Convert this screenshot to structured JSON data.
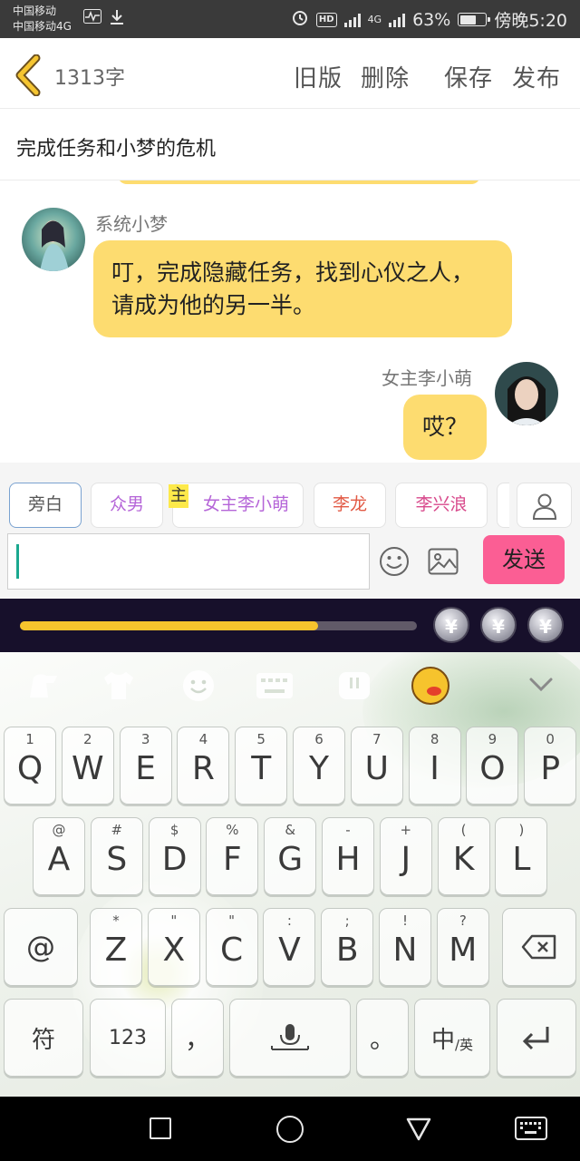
{
  "status_bar": {
    "carrier_1": "中国移动",
    "carrier_2": "中国移动4G",
    "network": "4G",
    "battery": "63%",
    "time": "傍晚5:20",
    "icons": [
      "activity-icon",
      "download-icon",
      "alarm-icon",
      "hd-icon",
      "signal-icon",
      "battery-icon"
    ]
  },
  "header": {
    "word_count": "1313字",
    "old_version": "旧版",
    "delete": "删除",
    "save": "保存",
    "publish": "发布"
  },
  "title": "完成任务和小梦的危机",
  "messages": [
    {
      "speaker": "系统小梦",
      "side": "left",
      "text": "叮，完成隐藏任务，找到心仪之人，请成为他的另一半。"
    },
    {
      "speaker": "女主李小萌",
      "side": "right",
      "text": "哎？"
    }
  ],
  "roles": {
    "items": [
      {
        "label": "旁白",
        "color": "#555555",
        "active": true
      },
      {
        "label": "众男",
        "color": "#b565d8"
      },
      {
        "label": "女主李小萌",
        "color": "#b565d8",
        "tag": "主"
      },
      {
        "label": "李龙",
        "color": "#e25a45"
      },
      {
        "label": "李兴浪",
        "color": "#d84a8c"
      }
    ]
  },
  "composer": {
    "input_value": "",
    "send": "发送",
    "icons": [
      "emoji-icon",
      "image-icon",
      "person-icon"
    ]
  },
  "progress": {
    "fraction": 0.75,
    "coin_symbol": "¥",
    "coin_count": 3
  },
  "keyboard": {
    "row1": [
      {
        "main": "Q",
        "sub": "1"
      },
      {
        "main": "W",
        "sub": "2"
      },
      {
        "main": "E",
        "sub": "3"
      },
      {
        "main": "R",
        "sub": "4"
      },
      {
        "main": "T",
        "sub": "5"
      },
      {
        "main": "Y",
        "sub": "6"
      },
      {
        "main": "U",
        "sub": "7"
      },
      {
        "main": "I",
        "sub": "8"
      },
      {
        "main": "O",
        "sub": "9"
      },
      {
        "main": "P",
        "sub": "0"
      }
    ],
    "row2": [
      {
        "main": "A",
        "sub": "@"
      },
      {
        "main": "S",
        "sub": "#"
      },
      {
        "main": "D",
        "sub": "$"
      },
      {
        "main": "F",
        "sub": "%"
      },
      {
        "main": "G",
        "sub": "&"
      },
      {
        "main": "H",
        "sub": "-"
      },
      {
        "main": "J",
        "sub": "+"
      },
      {
        "main": "K",
        "sub": "("
      },
      {
        "main": "L",
        "sub": ")"
      }
    ],
    "row3": [
      {
        "main": "Z",
        "sub": "*"
      },
      {
        "main": "X",
        "sub": "\""
      },
      {
        "main": "C",
        "sub": "\""
      },
      {
        "main": "V",
        "sub": ":"
      },
      {
        "main": "B",
        "sub": ";"
      },
      {
        "main": "N",
        "sub": "!"
      },
      {
        "main": "M",
        "sub": "?"
      }
    ],
    "at_key": "@",
    "symbols_key": "符",
    "num_key": "123",
    "comma_key": "，",
    "period_key": "。",
    "lang_key_main": "中",
    "lang_key_sub": "/英",
    "toolbar_icons": [
      "swipe-icon",
      "tshirt-icon",
      "smiley-icon",
      "keyboard-icon",
      "clipboard-icon",
      "mascot-icon",
      "chevron-down-icon"
    ]
  },
  "nav_bar": {
    "icons": [
      "recent-apps-icon",
      "home-icon",
      "back-icon",
      "keyboard-toggle-icon"
    ]
  }
}
